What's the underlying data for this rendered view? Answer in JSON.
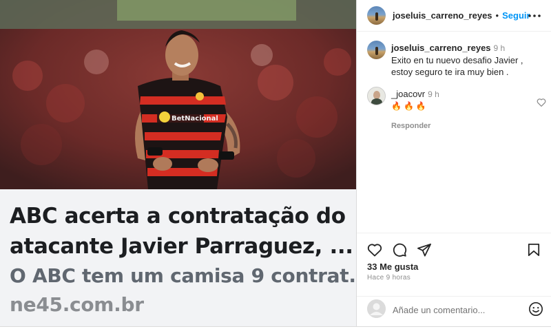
{
  "header": {
    "username": "joseluis_carreno_reyes",
    "separator": "•",
    "follow_label": "Seguir",
    "more_icon": "more-horizontal-icon"
  },
  "media": {
    "headline_line1": "ABC acerta a contratação do",
    "headline_line2": "atacante Javier Parraguez, ...",
    "description": "O ABC tem um camisa 9 contrat...",
    "domain": "ne45.com.br",
    "jersey_sponsor": "BetNacional"
  },
  "caption": {
    "username": "joseluis_carreno_reyes",
    "time": "9 h",
    "text": "Exito en tu nuevo desafio Javier , estoy seguro te ira muy bien ."
  },
  "comments": [
    {
      "username": "_joacovr",
      "time": "9 h",
      "text": "🔥🔥🔥",
      "reply_label": "Responder"
    }
  ],
  "actions": {
    "like_icon": "heart-icon",
    "comment_icon": "comment-icon",
    "share_icon": "share-icon",
    "save_icon": "bookmark-icon"
  },
  "likes": "33 Me gusta",
  "posted_ago": "Hace 9 horas",
  "comment_box": {
    "placeholder": "Añade un comentario...",
    "emoji_icon": "emoji-icon"
  },
  "colors": {
    "accent": "#0095f6",
    "text": "#262626",
    "muted": "#8e8e8e",
    "border": "#dbdbdb"
  }
}
